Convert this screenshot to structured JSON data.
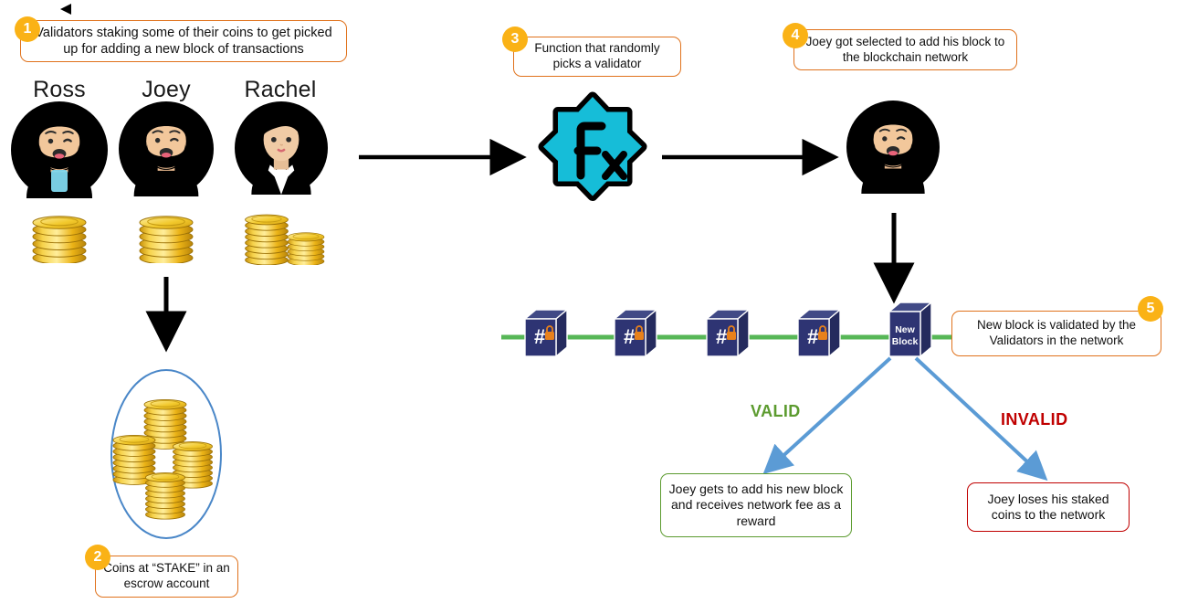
{
  "diagram": {
    "title": "Proof of Stake validator selection flow",
    "colors": {
      "callout_border": "#E0721C",
      "badge": "#FAB216",
      "valid": "#5C9B2F",
      "invalid": "#C00000",
      "chain_line": "#57B757",
      "block": "#2E3473",
      "block_top": "#414A86",
      "lock": "#E8811B",
      "blue_arrow": "#5B9BD5",
      "escrow_oval": "#4A87C8",
      "fx_badge": "#16BDD8"
    }
  },
  "callouts": [
    {
      "id": "step-1",
      "number": "1",
      "text": "Validators staking some of their coins to get picked up for adding a new block of transactions"
    },
    {
      "id": "step-2",
      "number": "2",
      "text": "Coins at “STAKE” in an escrow account"
    },
    {
      "id": "step-3",
      "number": "3",
      "text": "Function that randomly picks a validator"
    },
    {
      "id": "step-4",
      "number": "4",
      "text": "Joey got selected to add his block to the blockchain network"
    },
    {
      "id": "step-5",
      "number": "5",
      "text": "New block is validated by the Validators in the network"
    }
  ],
  "outcomes": {
    "valid_label": "VALID",
    "invalid_label": "INVALID",
    "valid_text": "Joey gets to add his new block and receives network fee as a reward",
    "invalid_text": "Joey loses his staked coins to the network"
  },
  "validators": [
    {
      "name": "Ross",
      "circle_color": "#F4604F",
      "shirt_color": "#2D6E72",
      "hair_color": "#8A6B4F"
    },
    {
      "name": "Joey",
      "circle_color": "#5B9BD5",
      "shirt_color": "#3B4A56",
      "hair_color": "#4A3226"
    },
    {
      "name": "Rachel",
      "circle_color": "#3E8C8C",
      "shirt_color": "#1F8A7A",
      "hair_color": "#9B4A2F"
    }
  ],
  "selected_validator": {
    "name": "Joey",
    "circle_color": "#5B9BD5"
  },
  "function_icon": {
    "label_f": "F",
    "label_x": "x",
    "name": "fx-function-icon"
  },
  "blockchain": {
    "blocks": [
      {
        "label": "#",
        "locked": true
      },
      {
        "label": "#",
        "locked": true
      },
      {
        "label": "#",
        "locked": true
      },
      {
        "label": "#",
        "locked": true
      }
    ],
    "new_block": {
      "line1": "New",
      "line2": "Block"
    }
  },
  "icons": {
    "top_marker": "left-triangle-marker",
    "coins": "coin-stack-icon",
    "escrow": "escrow-oval",
    "padlock": "padlock-icon"
  }
}
